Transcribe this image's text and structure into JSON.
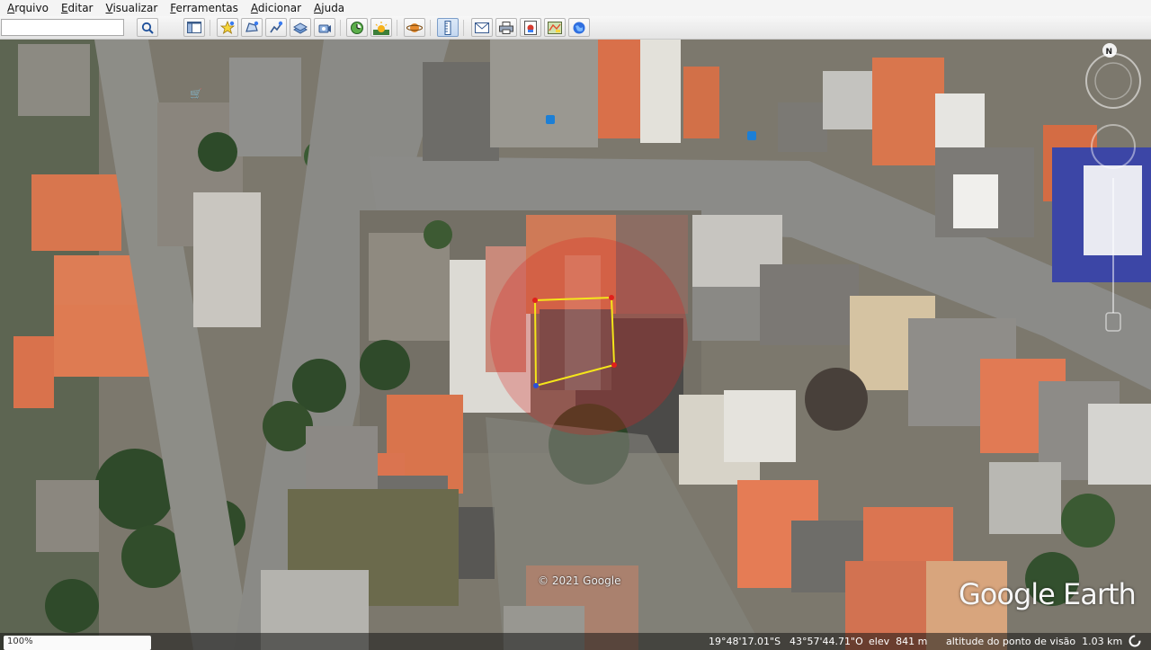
{
  "menu": {
    "items": [
      "Arquivo",
      "Editar",
      "Visualizar",
      "Ferramentas",
      "Adicionar",
      "Ajuda"
    ]
  },
  "search": {
    "value": ""
  },
  "toolbar": {
    "buttons": [
      {
        "name": "search-button",
        "icon": "magnifier-icon"
      },
      {
        "name": "sidebar-toggle-button",
        "icon": "sidebar-icon"
      },
      {
        "name": "add-placemark-button",
        "icon": "pushpin-icon"
      },
      {
        "name": "add-polygon-button",
        "icon": "polygon-icon"
      },
      {
        "name": "add-path-button",
        "icon": "path-icon"
      },
      {
        "name": "image-overlay-button",
        "icon": "overlay-icon"
      },
      {
        "name": "record-tour-button",
        "icon": "tour-icon"
      },
      {
        "name": "historical-imagery-button",
        "icon": "clock-icon"
      },
      {
        "name": "sunlight-button",
        "icon": "sun-icon"
      },
      {
        "name": "planet-switch-button",
        "icon": "planet-icon"
      },
      {
        "name": "ruler-button",
        "icon": "ruler-icon"
      },
      {
        "name": "email-button",
        "icon": "envelope-icon"
      },
      {
        "name": "print-button",
        "icon": "printer-icon"
      },
      {
        "name": "save-image-button",
        "icon": "save-image-icon"
      },
      {
        "name": "view-in-maps-button",
        "icon": "map-icon"
      },
      {
        "name": "earth-gallery-button",
        "icon": "globe-icon"
      }
    ]
  },
  "map": {
    "copyright": "© 2021 Google",
    "logo": "Google Earth",
    "compass_label": "N",
    "polygon_color": "#f5e61a",
    "marker_color": "#e0201b",
    "vertex_color": "#2b4fd8"
  },
  "status": {
    "lat": "19°48'17.01\"S",
    "lon": "43°57'44.71\"O",
    "elev": "elev  841 m",
    "eye_alt": "altitude do ponto de visão  1.03 km",
    "loader_label": "100%"
  }
}
